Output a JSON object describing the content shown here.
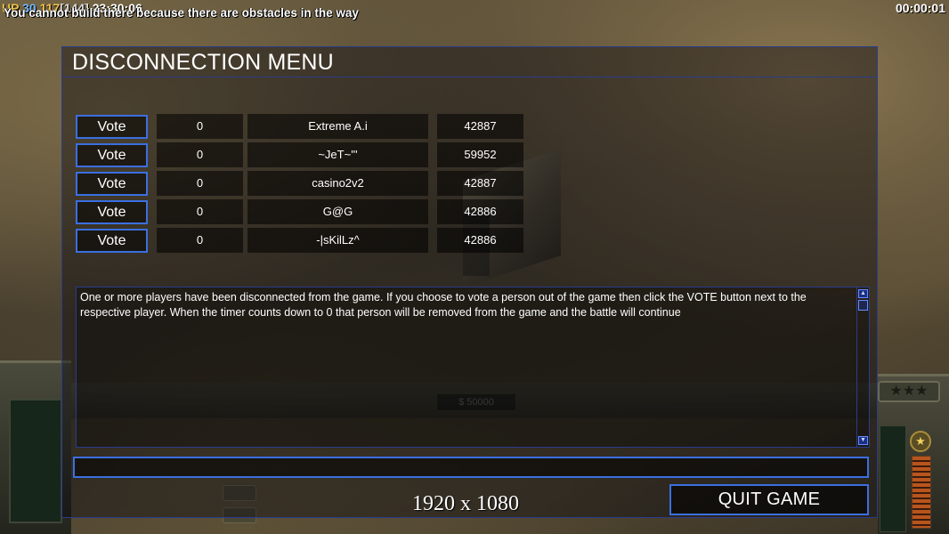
{
  "hud": {
    "stats_a": "UP",
    "stats_b": "30",
    "stats_c": "117",
    "stats_d": "[144]",
    "stats_e": "23:30:06",
    "message": "You cannot build there because there are obstacles in the way",
    "timer": "00:00:01"
  },
  "background": {
    "money": "$ 50000",
    "stars": "★★★",
    "rank": "★"
  },
  "dialog": {
    "title": "DISCONNECTION MENU",
    "vote_label": "Vote",
    "players": [
      {
        "count": "0",
        "name": "Extreme A.i",
        "ping": "42887"
      },
      {
        "count": "0",
        "name": "~JeT~'''",
        "ping": "59952"
      },
      {
        "count": "0",
        "name": "casino2v2",
        "ping": "42887"
      },
      {
        "count": "0",
        "name": "G@G",
        "ping": "42886"
      },
      {
        "count": "0",
        "name": "-|sKilLz^",
        "ping": "42886"
      }
    ],
    "info_text": "One or more players have been disconnected from the game. If you choose to vote a person out of the game then click the VOTE button next to the respective player. When the timer counts down to 0 that person will be removed from the game and the battle will continue",
    "chat_value": "",
    "quit_label": "QUIT GAME"
  },
  "overlay": {
    "resolution": "1920 x 1080"
  },
  "colors": {
    "accent_border": "#3a6fe0",
    "frame_border": "#2a3c8c"
  }
}
